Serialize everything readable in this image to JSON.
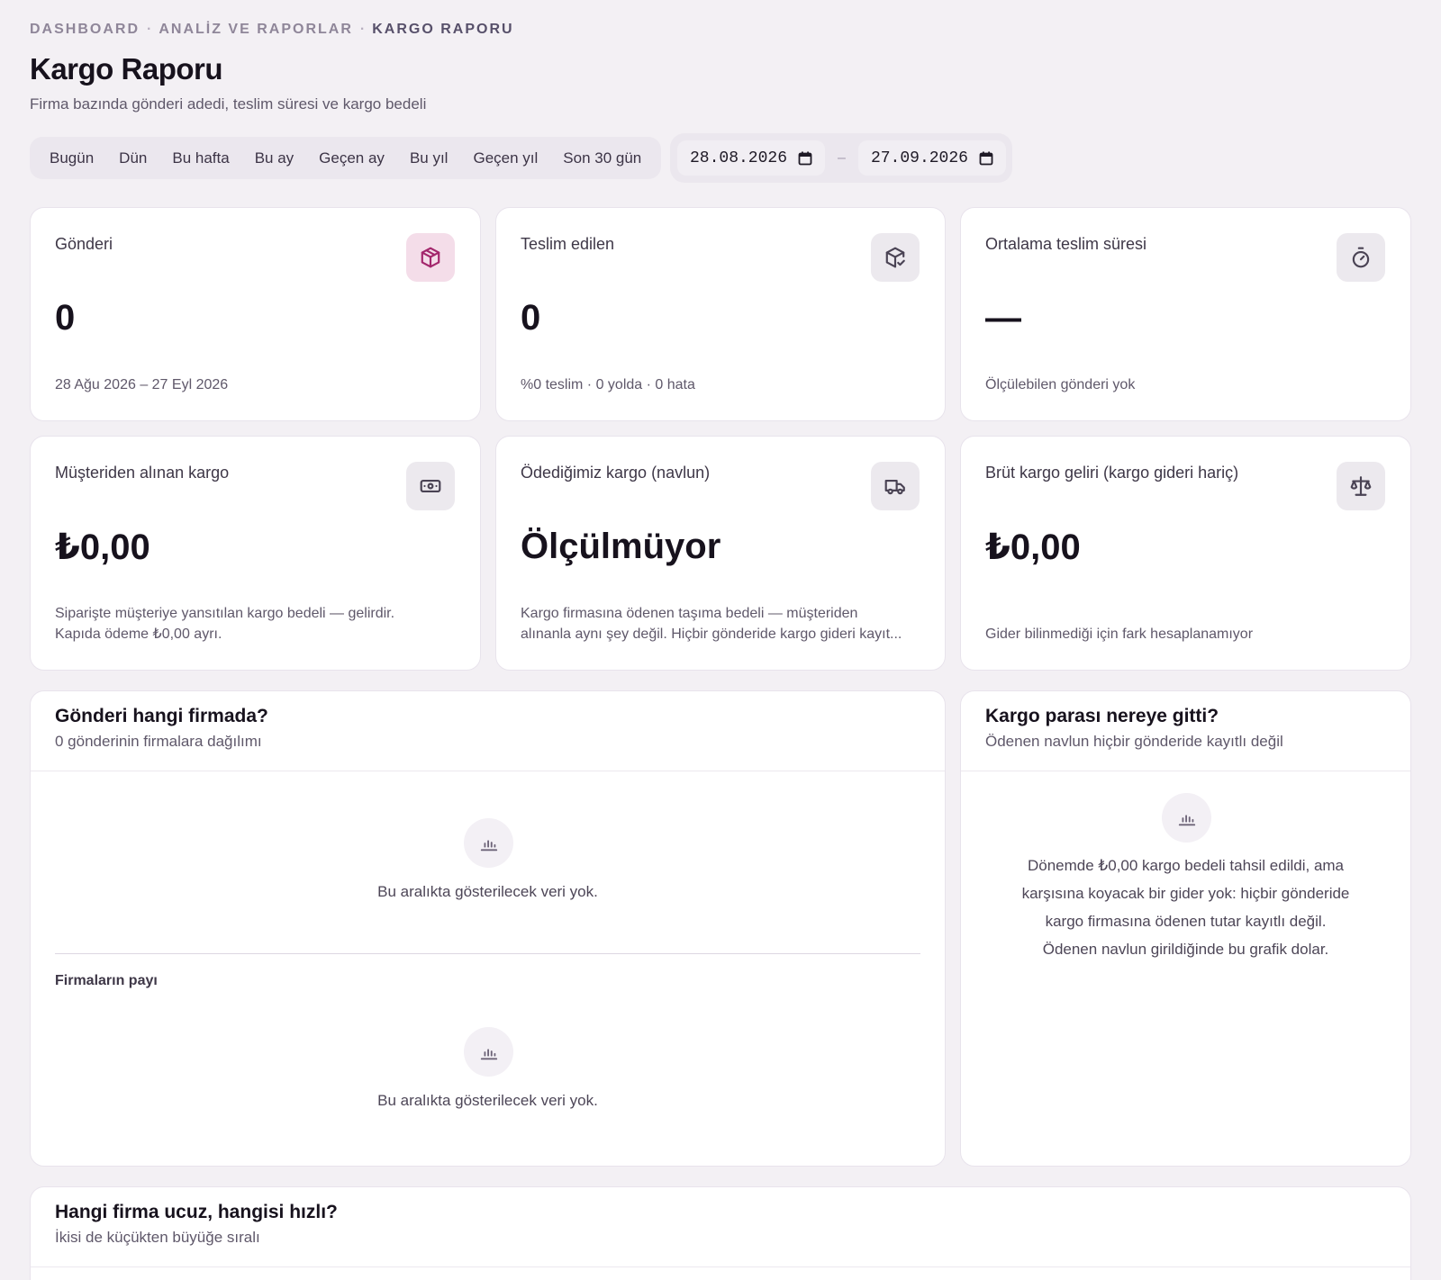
{
  "breadcrumb": {
    "items": [
      "DASHBOARD",
      "ANALİZ VE RAPORLAR",
      "KARGO RAPORU"
    ],
    "separator": "·"
  },
  "header": {
    "title": "Kargo Raporu",
    "subtitle": "Firma bazında gönderi adedi, teslim süresi ve kargo bedeli"
  },
  "range_presets": [
    "Bugün",
    "Dün",
    "Bu hafta",
    "Bu ay",
    "Geçen ay",
    "Bu yıl",
    "Geçen yıl",
    "Son 30 gün"
  ],
  "date_range": {
    "start": "28.08.2026",
    "end": "27.09.2026",
    "separator": "–"
  },
  "stats": {
    "shipments": {
      "label": "Gönderi",
      "value": "0",
      "foot": "28 Ağu 2026 – 27 Eyl 2026",
      "icon": "package-icon"
    },
    "delivered": {
      "label": "Teslim edilen",
      "value": "0",
      "foot": "%0 teslim · 0 yolda · 0 hata",
      "icon": "package-check-icon"
    },
    "avg_delivery": {
      "label": "Ortalama teslim süresi",
      "value": "—",
      "foot": "Ölçülebilen gönderi yok",
      "icon": "stopwatch-icon"
    },
    "customer_shipping": {
      "label": "Müşteriden alınan kargo",
      "value": "₺0,00",
      "foot_line1": "Siparişte müşteriye yansıtılan kargo bedeli — gelirdir.",
      "foot_line2": "Kapıda ödeme ₺0,00 ayrı.",
      "icon": "banknote-icon"
    },
    "paid_freight": {
      "label": "Ödediğimiz kargo (navlun)",
      "value": "Ölçülmüyor",
      "foot_line1": "Kargo firmasına ödenen taşıma bedeli — müşteriden",
      "foot_line2": "alınanla aynı şey değil. Hiçbir gönderide kargo gideri kayıt...",
      "icon": "truck-icon"
    },
    "gross_shipping": {
      "label": "Brüt kargo geliri (kargo gideri hariç)",
      "value": "₺0,00",
      "foot": "Gider bilinmediği için fark hesaplanamıyor",
      "icon": "scale-icon"
    }
  },
  "carrier_panel": {
    "title": "Gönderi hangi firmada?",
    "subtitle": "0 gönderinin firmalara dağılımı",
    "empty_text": "Bu aralıkta gösterilecek veri yok.",
    "share_label": "Firmaların payı",
    "share_empty_text": "Bu aralıkta gösterilecek veri yok."
  },
  "money_panel": {
    "title": "Kargo parası nereye gitti?",
    "subtitle": "Ödenen navlun hiçbir gönderide kayıtlı değil",
    "note_lines": [
      "Dönemde ₺0,00 kargo bedeli tahsil edildi, ama",
      "karşısına koyacak bir gider yok: hiçbir gönderide",
      "kargo firmasına ödenen tutar kayıtlı değil.",
      "Ödenen navlun girildiğinde bu grafik dolar."
    ]
  },
  "compare_panel": {
    "title": "Hangi firma ucuz, hangisi hızlı?",
    "subtitle": "İkisi de küçükten büyüğe sıralı"
  },
  "colors": {
    "background": "#f3f0f4",
    "accent": "#a3266c",
    "accent_bg": "#f4dde9"
  }
}
